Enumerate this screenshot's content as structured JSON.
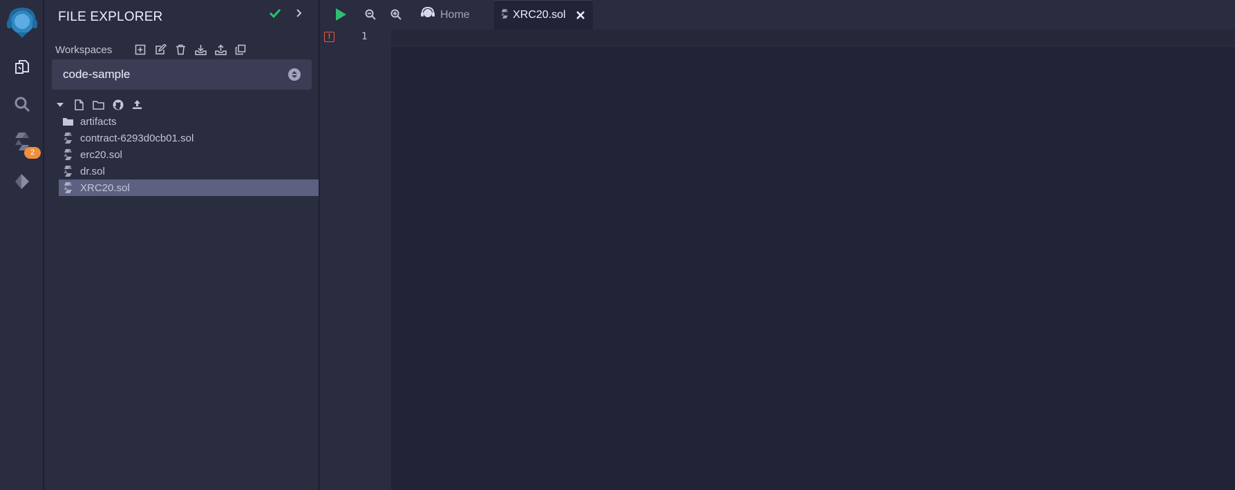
{
  "sidebar": {
    "badge_count": "2"
  },
  "file_explorer": {
    "title": "FILE EXPLORER",
    "workspaces_label": "Workspaces",
    "workspace_selected": "code-sample",
    "files": [
      {
        "name": "artifacts",
        "kind": "folder"
      },
      {
        "name": "contract-6293d0cb01.sol",
        "kind": "sol"
      },
      {
        "name": "erc20.sol",
        "kind": "sol"
      },
      {
        "name": "dr.sol",
        "kind": "sol"
      },
      {
        "name": "XRC20.sol",
        "kind": "sol",
        "selected": true
      }
    ]
  },
  "tabs": {
    "home_label": "Home",
    "active_label": "XRC20.sol"
  },
  "editor": {
    "line_number": "1",
    "warning_glyph": "!"
  },
  "colors": {
    "accent_green": "#2fbf71",
    "badge_orange": "#f18e3c",
    "warning_red": "#e35f3f",
    "brand_blue": "#2e86c1"
  }
}
